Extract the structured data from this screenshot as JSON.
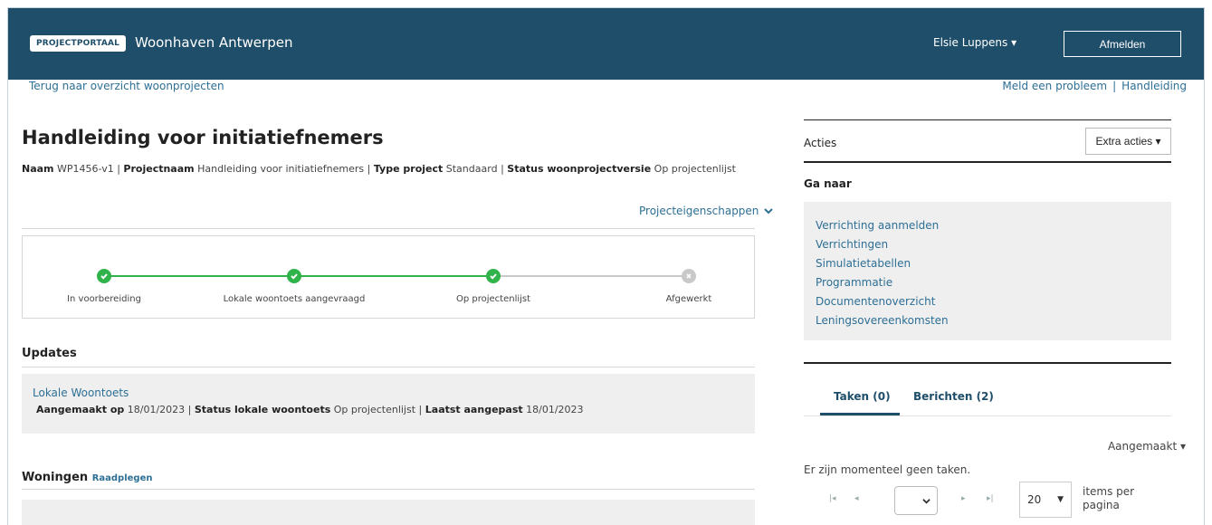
{
  "header": {
    "badge": "PROJECTPORTAAL",
    "title": "Woonhaven Antwerpen",
    "user": "Elsie Luppens ▾",
    "logout": "Afmelden"
  },
  "nav": {
    "back": "Terug naar overzicht woonprojecten",
    "report": "Meld een probleem",
    "separator": "|",
    "manual": "Handleiding"
  },
  "page": {
    "title": "Handleiding voor initiatiefnemers",
    "meta": {
      "naam_label": "Naam",
      "naam_value": "WP1456-v1",
      "projectnaam_label": "Projectnaam",
      "projectnaam_value": "Handleiding voor initiatiefnemers",
      "type_label": "Type project",
      "type_value": "Standaard",
      "status_label": "Status woonprojectversie",
      "status_value": "Op projectenlijst",
      "sep": "|"
    },
    "properties_link": "Projecteigenschappen"
  },
  "stepper": {
    "steps": [
      {
        "label": "In voorbereiding",
        "done": true
      },
      {
        "label": "Lokale woontoets aangevraagd",
        "done": true
      },
      {
        "label": "Op projectenlijst",
        "done": true
      },
      {
        "label": "Afgewerkt",
        "done": false
      }
    ],
    "colors": {
      "done": "#2fb34a",
      "todo": "#c9c9c9"
    }
  },
  "updates": {
    "title": "Updates",
    "item": {
      "link": "Lokale Woontoets",
      "created_label": "Aangemaakt op",
      "created_value": "18/01/2023",
      "status_label": "Status lokale woontoets",
      "status_value": "Op projectenlijst",
      "modified_label": "Laatst aangepast",
      "modified_value": "18/01/2023",
      "sep": "|"
    }
  },
  "woningen": {
    "title": "Woningen",
    "link": "Raadplegen"
  },
  "acties": {
    "label": "Acties",
    "extra": "Extra acties ▾"
  },
  "goto": {
    "title": "Ga naar",
    "links": [
      "Verrichting aanmelden",
      "Verrichtingen",
      "Simulatietabellen",
      "Programmatie",
      "Documentenoverzicht",
      "Leningsovereenkomsten"
    ]
  },
  "tabs": {
    "items": [
      "Taken (0)",
      "Berichten (2)"
    ],
    "sort": "Aangemaakt ▾",
    "empty": "Er zijn momenteel geen taken.",
    "per_page": "20",
    "per_page_label": "items per pagina"
  },
  "colors": {
    "header_bg": "#1f4e6a",
    "link": "#2d6f95",
    "panel_bg": "#efefef"
  }
}
